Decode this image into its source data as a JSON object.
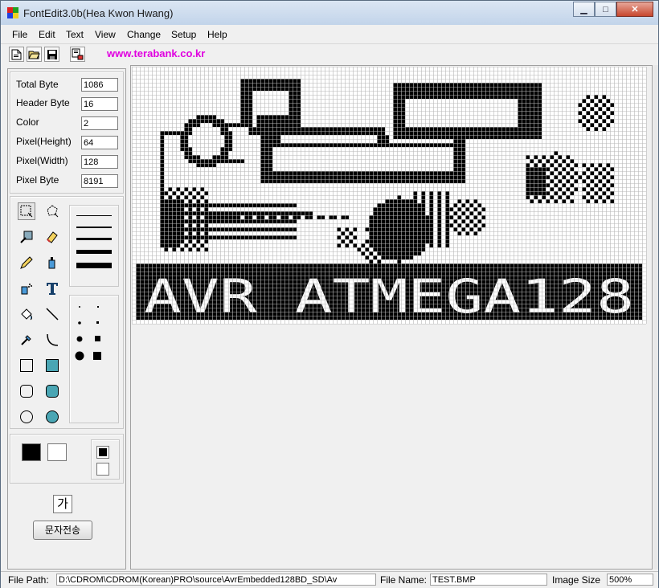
{
  "window": {
    "title": "FontEdit3.0b(Hea Kwon Hwang)",
    "minimize": "▁",
    "maximize": "□",
    "close": "✕"
  },
  "menu": [
    "File",
    "Edit",
    "Text",
    "View",
    "Change",
    "Setup",
    "Help"
  ],
  "toolbar": {
    "url": "www.terabank.co.kr"
  },
  "info_fields": [
    {
      "label": "Total Byte",
      "value": "1086"
    },
    {
      "label": "Header Byte",
      "value": "16"
    },
    {
      "label": "Color",
      "value": "2"
    },
    {
      "label": "Pixel(Height)",
      "value": "64"
    },
    {
      "label": "Pixel(Width)",
      "value": "128"
    },
    {
      "label": "Pixel Byte",
      "value": "8191"
    }
  ],
  "tools": [
    "select-rect-icon",
    "select-lasso-icon",
    "pick-color-icon",
    "eraser-icon",
    "pencil-icon",
    "spray-icon",
    "airbrush-icon",
    "text-tool-icon",
    "fill-icon",
    "line-icon",
    "eyedropper-icon",
    "curve-icon",
    "rectangle-icon",
    "filled-rectangle-icon",
    "rounded-rect-icon",
    "filled-rounded-rect-icon",
    "ellipse-icon",
    "filled-ellipse-icon"
  ],
  "char_preview": "가",
  "send_button": "문자전송",
  "canvas": {
    "banner_text": "AVR ATMEGA128",
    "cols": 128,
    "rows": 64
  },
  "status": {
    "file_path_label": "File Path:",
    "file_path_value": "D:\\CDROM\\CDROM(Korean)PRO\\source\\AvrEmbedded128BD_SD\\Av",
    "file_name_label": "File Name:",
    "file_name_value": "TEST.BMP",
    "image_size_label": "Image Size",
    "image_size_value": "500%"
  }
}
